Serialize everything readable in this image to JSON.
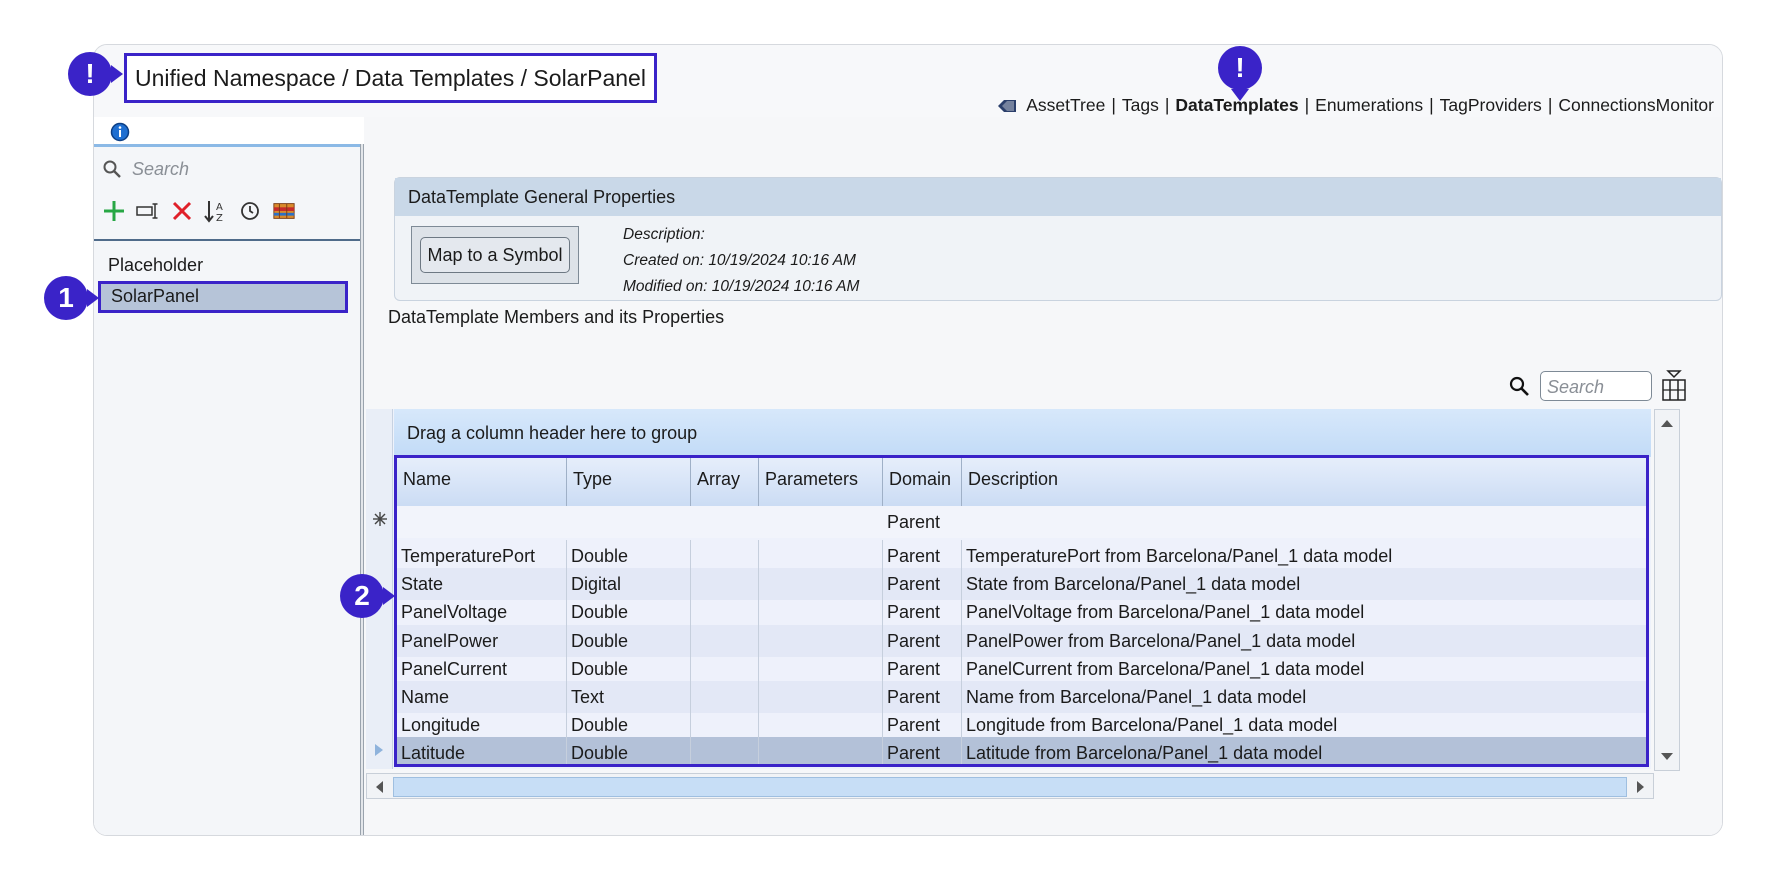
{
  "header": {
    "breadcrumb": "Unified Namespace / Data Templates / SolarPanel",
    "nav": {
      "asset_tree": "AssetTree",
      "tags": "Tags",
      "data_templates": "DataTemplates",
      "enumerations": "Enumerations",
      "tag_providers": "TagProviders",
      "connections_monitor": "ConnectionsMonitor",
      "separator": "|"
    }
  },
  "left_panel": {
    "search_placeholder": "Search",
    "toolbar_icons": [
      "add-icon",
      "rename-icon",
      "delete-icon",
      "sort-az-icon",
      "history-icon",
      "library-icon"
    ],
    "items": [
      {
        "label": "Placeholder",
        "selected": false
      },
      {
        "label": "SolarPanel",
        "selected": true
      }
    ]
  },
  "general": {
    "title": "DataTemplate General Properties",
    "map_button": "Map to a Symbol",
    "description_label": "Description:",
    "created_label": "Created on:",
    "created_value": "10/19/2024 10:16 AM",
    "modified_label": "Modified on:",
    "modified_value": "10/19/2024 10:16 AM"
  },
  "members": {
    "label": "DataTemplate Members and its Properties",
    "search_placeholder": "Search",
    "group_hint": "Drag a column header here to group",
    "columns": [
      "Name",
      "Type",
      "Array",
      "Parameters",
      "Domain",
      "Description"
    ],
    "new_row_domain": "Parent",
    "rows": [
      {
        "name": "TemperaturePort",
        "type": "Double",
        "array": "",
        "parameters": "",
        "domain": "Parent",
        "description": "TemperaturePort from Barcelona/Panel_1 data model"
      },
      {
        "name": "State",
        "type": "Digital",
        "array": "",
        "parameters": "",
        "domain": "Parent",
        "description": "State from Barcelona/Panel_1 data model"
      },
      {
        "name": "PanelVoltage",
        "type": "Double",
        "array": "",
        "parameters": "",
        "domain": "Parent",
        "description": "PanelVoltage from Barcelona/Panel_1 data model"
      },
      {
        "name": "PanelPower",
        "type": "Double",
        "array": "",
        "parameters": "",
        "domain": "Parent",
        "description": "PanelPower from Barcelona/Panel_1 data model"
      },
      {
        "name": "PanelCurrent",
        "type": "Double",
        "array": "",
        "parameters": "",
        "domain": "Parent",
        "description": "PanelCurrent from Barcelona/Panel_1 data model"
      },
      {
        "name": "Name",
        "type": "Text",
        "array": "",
        "parameters": "",
        "domain": "Parent",
        "description": "Name from Barcelona/Panel_1 data model"
      },
      {
        "name": "Longitude",
        "type": "Double",
        "array": "",
        "parameters": "",
        "domain": "Parent",
        "description": "Longitude from Barcelona/Panel_1 data model"
      },
      {
        "name": "Latitude",
        "type": "Double",
        "array": "",
        "parameters": "",
        "domain": "Parent",
        "description": "Latitude from Barcelona/Panel_1 data model",
        "selected": true
      }
    ]
  },
  "annotations": {
    "marker_header": "!",
    "marker_nav": "!",
    "marker_tree": "1",
    "marker_table": "2"
  },
  "colors": {
    "accent": "#3a23c8",
    "selected_row": "#b3c1d8",
    "group_bar": "#c2dbf7"
  }
}
